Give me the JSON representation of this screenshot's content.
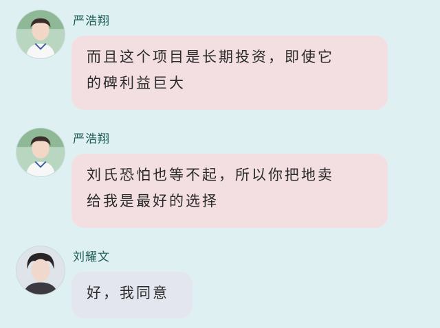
{
  "messages": [
    {
      "sender": "严浩翔",
      "lines": [
        "而且这个项目是长期投资，即使它",
        "的碑利益巨大"
      ],
      "style": "pink"
    },
    {
      "sender": "严浩翔",
      "lines": [
        "刘氏恐怕也等不起，所以你把地卖",
        "给我是最好的选择"
      ],
      "style": "pink"
    },
    {
      "sender": "刘耀文",
      "lines": [
        "好，我同意"
      ],
      "style": "gray"
    }
  ],
  "colors": {
    "background": "#dff0f2",
    "bubble_pink": "#f3dfe1",
    "bubble_gray": "#e3e6ee",
    "sender_name": "#1c5c56"
  }
}
